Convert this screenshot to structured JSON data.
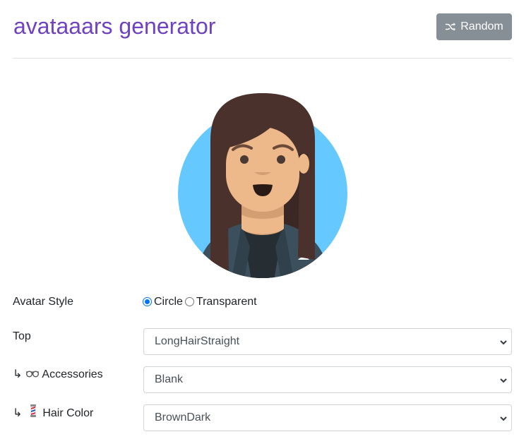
{
  "header": {
    "title": "avataaars generator",
    "random_label": "Random"
  },
  "colors": {
    "title": "#6f42c1",
    "button": "#868e96",
    "avatar_bg": "#65c9ff",
    "skin": "#edb98a",
    "hair": "#4a312c",
    "clothes": "#3c4f5c"
  },
  "form": {
    "avatar_style": {
      "label": "Avatar Style",
      "options": [
        "Circle",
        "Transparent"
      ],
      "selected": "Circle"
    },
    "top": {
      "label": "Top",
      "value": "LongHairStraight"
    },
    "accessories": {
      "label": "Accessories",
      "prefix": "↳",
      "icon": "glasses-icon",
      "value": "Blank"
    },
    "hair_color": {
      "label": "Hair Color",
      "prefix": "↳",
      "icon": "barber-pole-icon",
      "value": "BrownDark"
    }
  }
}
